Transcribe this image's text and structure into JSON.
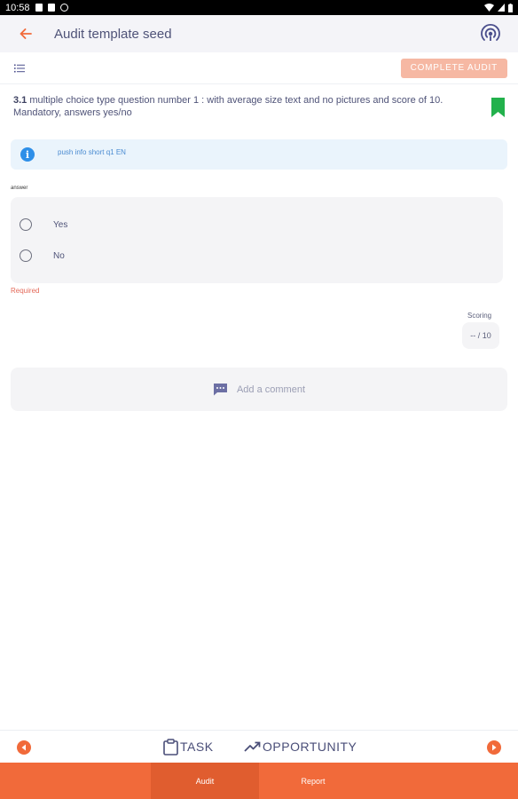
{
  "status_bar": {
    "time": "10:58"
  },
  "app_bar": {
    "title": "Audit template seed",
    "back_icon": "arrow-left-icon",
    "sync_icon": "broadcast-icon"
  },
  "toolbar": {
    "complete_label": "COMPLETE AUDIT"
  },
  "question": {
    "number": "3.1",
    "text": " multiple choice type question number 1 : with average size text and no pictures and score of 10. Mandatory, answers yes/no",
    "bookmark_color": "#22b14c"
  },
  "info": {
    "text": "push info short q1 EN"
  },
  "answer": {
    "label": "answer",
    "options": [
      {
        "label": "Yes"
      },
      {
        "label": "No"
      }
    ],
    "required_text": "Required"
  },
  "scoring": {
    "label": "Scoring",
    "value": "-- / 10"
  },
  "comment": {
    "placeholder": "Add a comment"
  },
  "bottom_nav": {
    "task_label": "TASK",
    "opportunity_label": "OPPORTUNITY"
  },
  "tabs": [
    {
      "label": "Audit",
      "active": true
    },
    {
      "label": "Report",
      "active": false
    }
  ],
  "colors": {
    "accent": "#f16a3a",
    "accent_light": "#f6b8a3",
    "info_blue": "#2e8fe8",
    "required_red": "#e46a5a"
  }
}
